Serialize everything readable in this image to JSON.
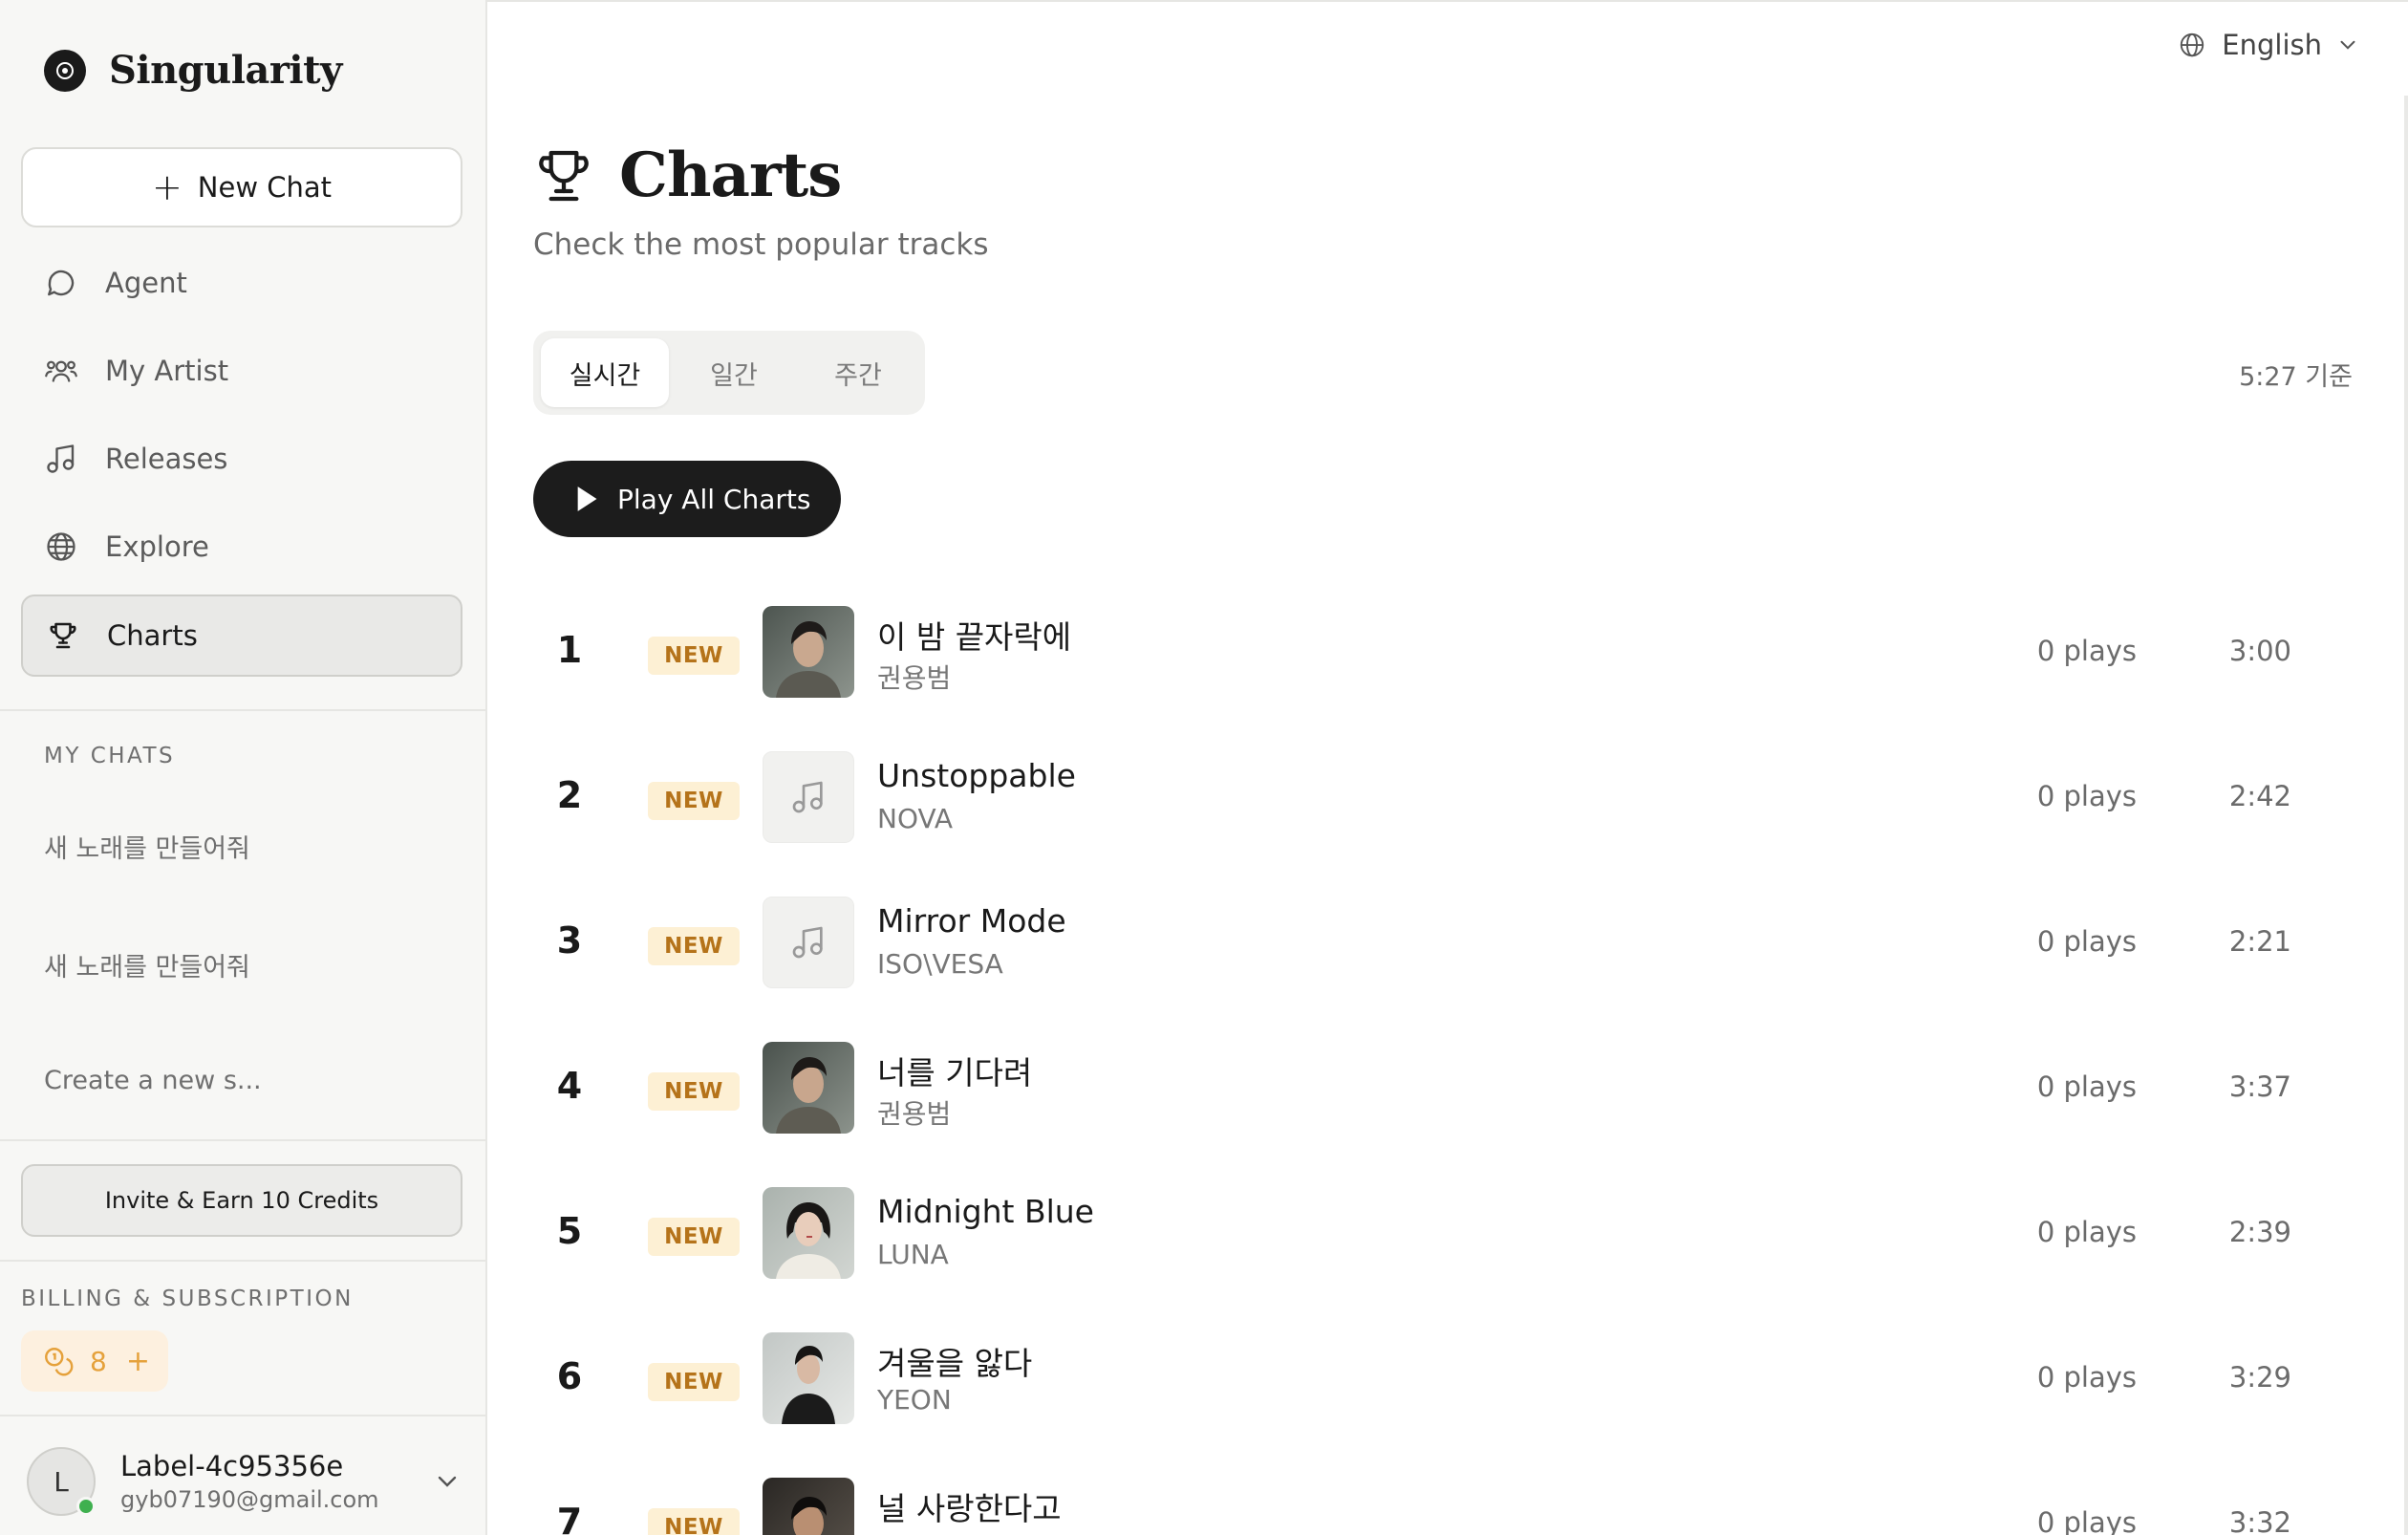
{
  "brand": {
    "name": "Singularity"
  },
  "sidebar": {
    "new_chat": "New Chat",
    "nav": [
      {
        "label": "Agent",
        "icon": "chat-bubble-icon"
      },
      {
        "label": "My Artist",
        "icon": "users-icon"
      },
      {
        "label": "Releases",
        "icon": "music-note-icon"
      },
      {
        "label": "Explore",
        "icon": "globe-icon"
      },
      {
        "label": "Charts",
        "icon": "trophy-icon",
        "active": true
      }
    ],
    "my_chats_label": "MY CHATS",
    "chats": [
      "새 노래를 만들어줘",
      "새 노래를 만들어줘",
      "Create a new s..."
    ],
    "invite": "Invite & Earn 10 Credits",
    "billing_label": "BILLING & SUBSCRIPTION",
    "credits": {
      "count": "8",
      "plus": "+"
    },
    "user": {
      "initial": "L",
      "name": "Label-4c95356e",
      "email": "gyb07190@gmail.com"
    }
  },
  "header": {
    "language": "English"
  },
  "page": {
    "title": "Charts",
    "subtitle": "Check the most popular tracks",
    "tabs": [
      {
        "label": "실시간",
        "active": true
      },
      {
        "label": "일간"
      },
      {
        "label": "주간"
      }
    ],
    "updated": "5:27 기준",
    "play_all": "Play All Charts"
  },
  "chart": {
    "badge": "NEW",
    "tracks": [
      {
        "rank": "1",
        "title": "이 밤 끝자락에",
        "artist": "권용범",
        "plays": "0 plays",
        "duration": "3:00",
        "cover": "photo"
      },
      {
        "rank": "2",
        "title": "Unstoppable",
        "artist": "NOVA",
        "plays": "0 plays",
        "duration": "2:42",
        "cover": "placeholder"
      },
      {
        "rank": "3",
        "title": "Mirror Mode",
        "artist": "ISO\\VESA",
        "plays": "0 plays",
        "duration": "2:21",
        "cover": "placeholder"
      },
      {
        "rank": "4",
        "title": "너를 기다려",
        "artist": "권용범",
        "plays": "0 plays",
        "duration": "3:37",
        "cover": "photo"
      },
      {
        "rank": "5",
        "title": "Midnight Blue",
        "artist": "LUNA",
        "plays": "0 plays",
        "duration": "2:39",
        "cover": "photo"
      },
      {
        "rank": "6",
        "title": "겨울을 앓다",
        "artist": "YEON",
        "plays": "0 plays",
        "duration": "3:29",
        "cover": "photo"
      },
      {
        "rank": "7",
        "title": "널 사랑한다고",
        "artist": "",
        "plays": "0 plays",
        "duration": "3:32",
        "cover": "photo"
      }
    ]
  },
  "colors": {
    "accent": "#1c1c1c",
    "badge_bg": "#fdf0d4",
    "badge_text": "#b5731a",
    "credits_bg": "#fdf0df",
    "credits_text": "#e5a13b",
    "online": "#3fb04f"
  }
}
